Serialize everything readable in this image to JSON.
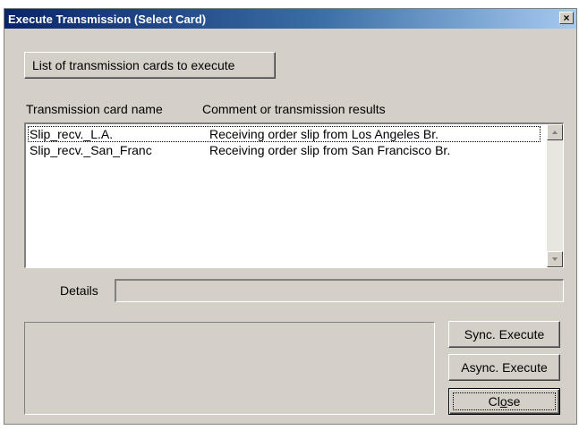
{
  "window": {
    "title": "Execute Transmission (Select Card)",
    "close_glyph": "×"
  },
  "card_list_button": {
    "label": "List of transmission cards to execute"
  },
  "table": {
    "columns": [
      "Transmission card name",
      "Comment or transmission results"
    ],
    "rows": [
      {
        "name": "Slip_recv._L.A.",
        "comment": "Receiving order slip from Los Angeles Br."
      },
      {
        "name": "Slip_recv._San_Franc",
        "comment": "Receiving order slip from San Francisco Br."
      }
    ]
  },
  "details": {
    "label": "Details",
    "value": ""
  },
  "buttons": {
    "sync_execute": "Sync. Execute",
    "async_execute": "Async. Execute",
    "close_pre": "Cl",
    "close_mnemonic": "o",
    "close_post": "se"
  },
  "icons": {
    "scroll_up": "scroll-up-arrow-icon",
    "scroll_down": "scroll-down-arrow-icon"
  },
  "colors": {
    "titlebar_start": "#0a246a",
    "titlebar_end": "#a6caf0",
    "face": "#d4d0c8"
  }
}
